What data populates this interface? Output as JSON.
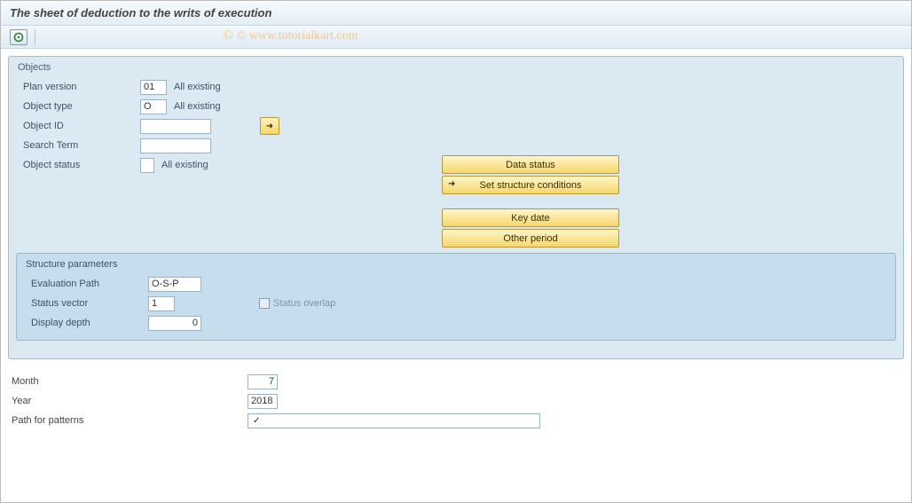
{
  "title": "The sheet of deduction to the writs of execution",
  "watermark": "© www.tutorialkart.com",
  "objects_panel": {
    "title": "Objects",
    "plan_version": {
      "label": "Plan version",
      "value": "01",
      "desc": "All existing"
    },
    "object_type": {
      "label": "Object type",
      "value": "O",
      "desc": "All existing"
    },
    "object_id": {
      "label": "Object ID",
      "value": ""
    },
    "search_term": {
      "label": "Search Term",
      "value": ""
    },
    "object_status": {
      "label": "Object status",
      "value": "",
      "desc": "All existing"
    },
    "buttons": {
      "data_status": "Data status",
      "set_struct": "Set structure conditions",
      "key_date": "Key date",
      "other_period": "Other period"
    }
  },
  "structure_panel": {
    "title": "Structure parameters",
    "eval_path": {
      "label": "Evaluation Path",
      "value": "O-S-P"
    },
    "status_vector": {
      "label": "Status vector",
      "value": "1"
    },
    "status_overlap": "Status overlap",
    "display_depth": {
      "label": "Display depth",
      "value": "0"
    }
  },
  "footer": {
    "month": {
      "label": "Month",
      "value": "7"
    },
    "year": {
      "label": "Year",
      "value": "2018"
    },
    "path": {
      "label": "Path for patterns",
      "value": ""
    }
  }
}
